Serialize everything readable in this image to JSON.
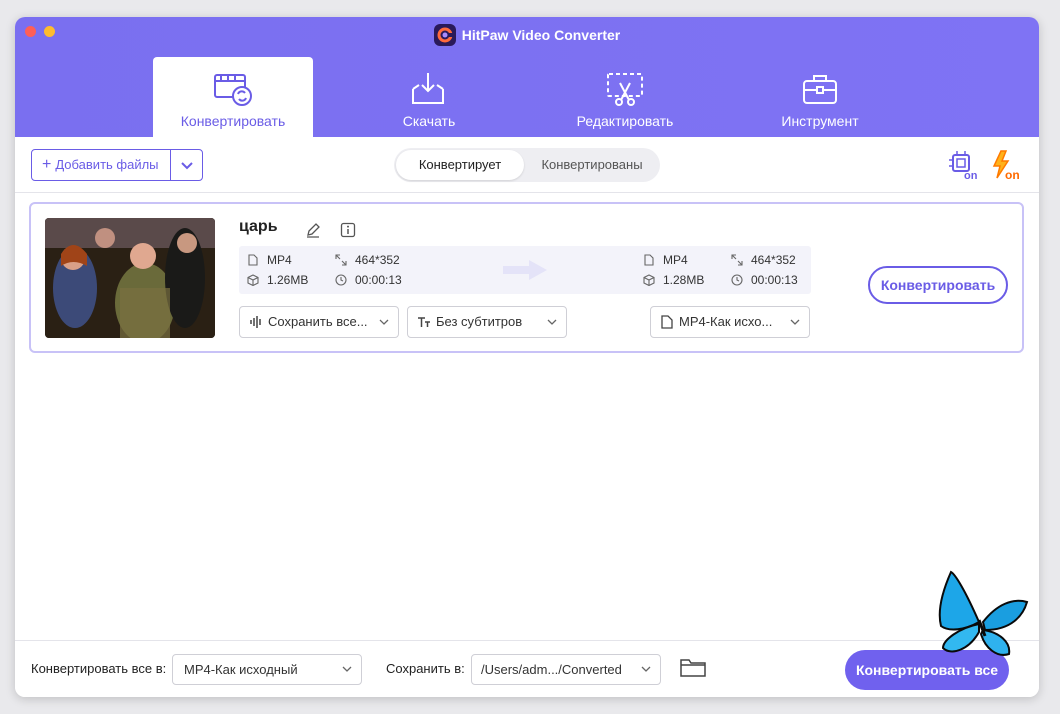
{
  "app": {
    "title": "HitPaw Video Converter",
    "accent": "#6a5ce6"
  },
  "tabs": [
    {
      "label": "Конвертировать",
      "icon": "film-convert-icon",
      "active": true
    },
    {
      "label": "Скачать",
      "icon": "download-tray-icon",
      "active": false
    },
    {
      "label": "Редактировать",
      "icon": "scissors-screen-icon",
      "active": false
    },
    {
      "label": "Инструмент",
      "icon": "toolbox-icon",
      "active": false
    }
  ],
  "toolbar": {
    "add_files_label": "Добавить файлы",
    "segment": {
      "converting": "Конвертирует",
      "converted": "Конвертированы"
    },
    "hw_accel_label": "on",
    "lightning_label": "on"
  },
  "file": {
    "name": "царь",
    "source": {
      "format": "MP4",
      "resolution": "464*352",
      "size": "1.26MB",
      "duration": "00:00:13"
    },
    "target": {
      "format": "MP4",
      "resolution": "464*352",
      "size": "1.28MB",
      "duration": "00:00:13"
    },
    "audio_select": "Сохранить все...",
    "subtitle_select": "Без субтитров",
    "format_select": "MP4-Как исхо...",
    "convert_button": "Конвертировать"
  },
  "footer": {
    "convert_all_to_label": "Конвертировать все в:",
    "convert_all_to_value": "MP4-Как исходный",
    "save_to_label": "Сохранить в:",
    "save_to_value": "/Users/adm.../Converted",
    "convert_all_button": "Конвертировать все"
  }
}
